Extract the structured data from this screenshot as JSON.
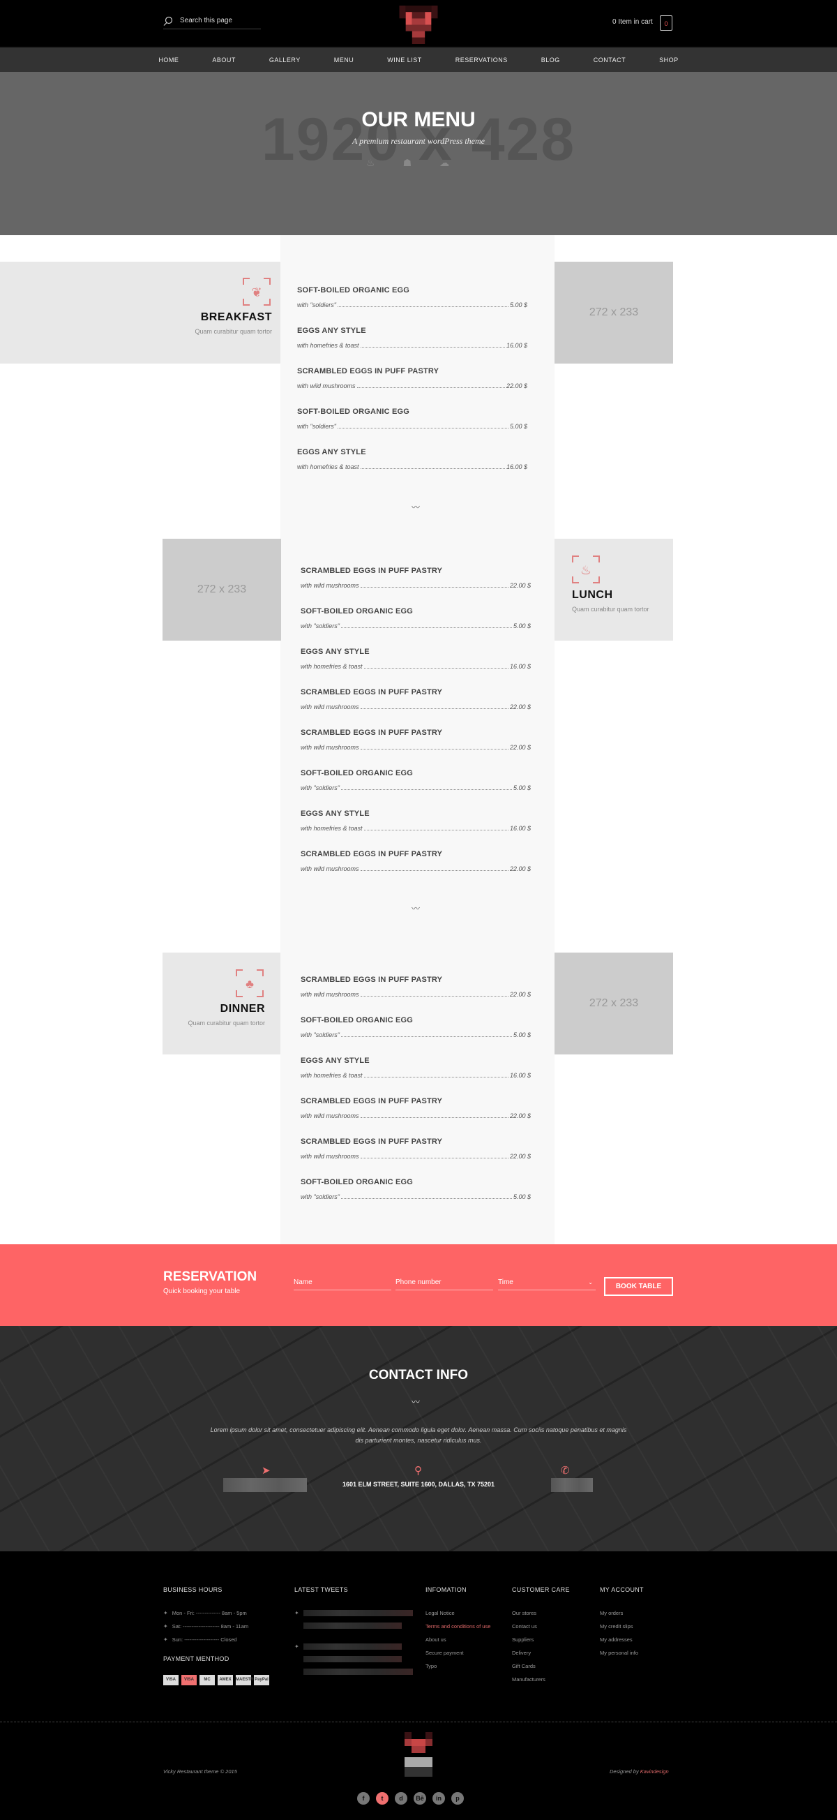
{
  "header": {
    "search_placeholder": "Search this page",
    "cart_label": "0 Item in cart",
    "cart_count": "0"
  },
  "nav": [
    "HOME",
    "ABOUT",
    "GALLERY",
    "MENU",
    "WINE LIST",
    "RESERVATIONS",
    "BLOG",
    "CONTACT",
    "SHOP"
  ],
  "hero": {
    "title": "OUR MENU",
    "subtitle": "A premium restaurant wordPress theme",
    "placeholder": "1920 x 428",
    "icons": [
      "pot-icon",
      "chicken-icon",
      "dish-icon"
    ]
  },
  "image_placeholder": "272 x 233",
  "accent": "#fe6465",
  "sections": [
    {
      "title": "BREAKFAST",
      "desc": "Quam curabitur quam tortor",
      "icon": "salad-bowl-icon",
      "items": [
        {
          "name": "SOFT-BOILED ORGANIC EGG",
          "desc": "with \"soldiers\"",
          "price": "5.00 $"
        },
        {
          "name": "EGGS ANY STYLE",
          "desc": "with homefries & toast",
          "price": "16.00 $"
        },
        {
          "name": "SCRAMBLED EGGS IN PUFF PASTRY",
          "desc": "with wild mushrooms",
          "price": "22.00 $"
        },
        {
          "name": "SOFT-BOILED ORGANIC EGG",
          "desc": "with \"soldiers\"",
          "price": "5.00 $"
        },
        {
          "name": "EGGS ANY STYLE",
          "desc": "with homefries & toast",
          "price": "16.00 $"
        }
      ]
    },
    {
      "title": "LUNCH",
      "desc": "Quam curabitur quam tortor",
      "icon": "pot-icon",
      "items": [
        {
          "name": "SCRAMBLED EGGS IN PUFF PASTRY",
          "desc": "with wild mushrooms",
          "price": "22.00 $"
        },
        {
          "name": "SOFT-BOILED ORGANIC EGG",
          "desc": "with \"soldiers\"",
          "price": "5.00 $"
        },
        {
          "name": "EGGS ANY STYLE",
          "desc": "with homefries & toast",
          "price": "16.00 $"
        },
        {
          "name": "SCRAMBLED EGGS IN PUFF PASTRY",
          "desc": "with wild mushrooms",
          "price": "22.00 $"
        },
        {
          "name": "SCRAMBLED EGGS IN PUFF PASTRY",
          "desc": "with wild mushrooms",
          "price": "22.00 $"
        },
        {
          "name": "SOFT-BOILED ORGANIC EGG",
          "desc": "with \"soldiers\"",
          "price": "5.00 $"
        },
        {
          "name": "EGGS ANY STYLE",
          "desc": "with homefries & toast",
          "price": "16.00 $"
        },
        {
          "name": "SCRAMBLED EGGS IN PUFF PASTRY",
          "desc": "with wild mushrooms",
          "price": "22.00 $"
        }
      ]
    },
    {
      "title": "DINNER",
      "desc": "Quam curabitur quam tortor",
      "icon": "roast-chicken-icon",
      "items": [
        {
          "name": "SCRAMBLED EGGS IN PUFF PASTRY",
          "desc": "with wild mushrooms",
          "price": "22.00 $"
        },
        {
          "name": "SOFT-BOILED ORGANIC EGG",
          "desc": "with \"soldiers\"",
          "price": "5.00 $"
        },
        {
          "name": "EGGS ANY STYLE",
          "desc": "with homefries & toast",
          "price": "16.00 $"
        },
        {
          "name": "SCRAMBLED EGGS IN PUFF PASTRY",
          "desc": "with wild mushrooms",
          "price": "22.00 $"
        },
        {
          "name": "SCRAMBLED EGGS IN PUFF PASTRY",
          "desc": "with wild mushrooms",
          "price": "22.00 $"
        },
        {
          "name": "SOFT-BOILED ORGANIC EGG",
          "desc": "with \"soldiers\"",
          "price": "5.00 $"
        }
      ]
    }
  ],
  "reservation": {
    "title": "RESERVATION",
    "subtitle": "Quick booking your table",
    "name_placeholder": "Name",
    "phone_placeholder": "Phone number",
    "time_placeholder": "Time",
    "button": "BOOK TABLE"
  },
  "contact": {
    "title": "CONTACT INFO",
    "text": "Lorem ipsum dolor sit amet, consectetuer adipiscing elit. Aenean commodo ligula eget dolor. Aenean massa. Cum sociis natoque penatibus et magnis dis parturient montes, nascetur ridiculus mus.",
    "address": "1601 ELM STREET, SUITE 1600, DALLAS, TX 75201"
  },
  "footer": {
    "hours_title": "BUSINESS HOURS",
    "hours": [
      "Mon - Fri: -------------- 8am - 5pm",
      "Sat: --------------------- 8am - 11am",
      "Sun: -------------------- Closed"
    ],
    "payment_title": "PAYMENT MENTHOD",
    "payments": [
      "VISA",
      "VISA",
      "MC",
      "AMEX",
      "MAESTRO",
      "PayPal"
    ],
    "tweets_title": "LATEST TWEETS",
    "info_title": "INFOMATION",
    "info": [
      "Legal Notice",
      "Terms and conditions of use",
      "About us",
      "Secure payment",
      "Typo"
    ],
    "care_title": "CUSTOMER CARE",
    "care": [
      "Our stores",
      "Contact us",
      "Suppliers",
      "Delivery",
      "Gift Cards",
      "Manufacturers"
    ],
    "account_title": "MY ACCOUNT",
    "account": [
      "My orders",
      "My credit slips",
      "My addresses",
      "My personal info"
    ],
    "copyright": "Vicky Restaurant theme © 2015",
    "designed_by": "Designed by ",
    "designer": "Kavindesign",
    "social": [
      "f",
      "t",
      "d",
      "Bē",
      "in",
      "p"
    ]
  }
}
